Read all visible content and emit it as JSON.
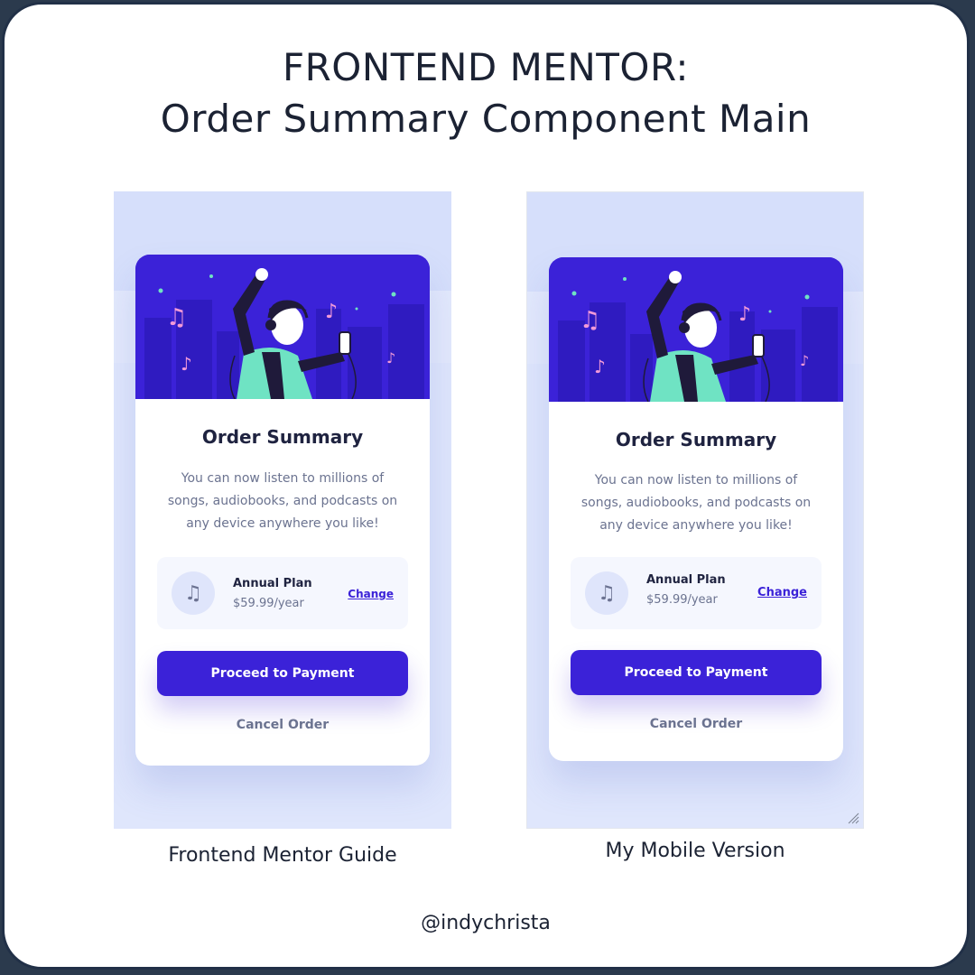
{
  "header": {
    "title_line1": "FRONTEND MENTOR:",
    "title_line2": "Order Summary Component Main"
  },
  "cards": [
    {
      "title": "Order Summary",
      "description": "You can now listen to millions of songs, audiobooks, and podcasts on any device anywhere you like!",
      "plan": {
        "icon": "music-note-icon",
        "name": "Annual Plan",
        "price": "$59.99/year",
        "change_label": "Change"
      },
      "pay_label": "Proceed to Payment",
      "cancel_label": "Cancel Order"
    },
    {
      "title": "Order Summary",
      "description": "You can now listen to millions of songs, audiobooks, and podcasts on any device anywhere you like!",
      "plan": {
        "icon": "music-note-icon",
        "name": "Annual Plan",
        "price": "$59.99/year",
        "change_label": "Change"
      },
      "pay_label": "Proceed to Payment",
      "cancel_label": "Cancel Order"
    }
  ],
  "captions": {
    "left": "Frontend Mentor Guide",
    "right": "My Mobile Version"
  },
  "footer": {
    "handle": "@indychrista"
  },
  "colors": {
    "primary": "#3b22d8",
    "panel_bg": "#d6dffb",
    "hero_accent": "#6fe3c3",
    "note_pink": "#f29ad8"
  }
}
